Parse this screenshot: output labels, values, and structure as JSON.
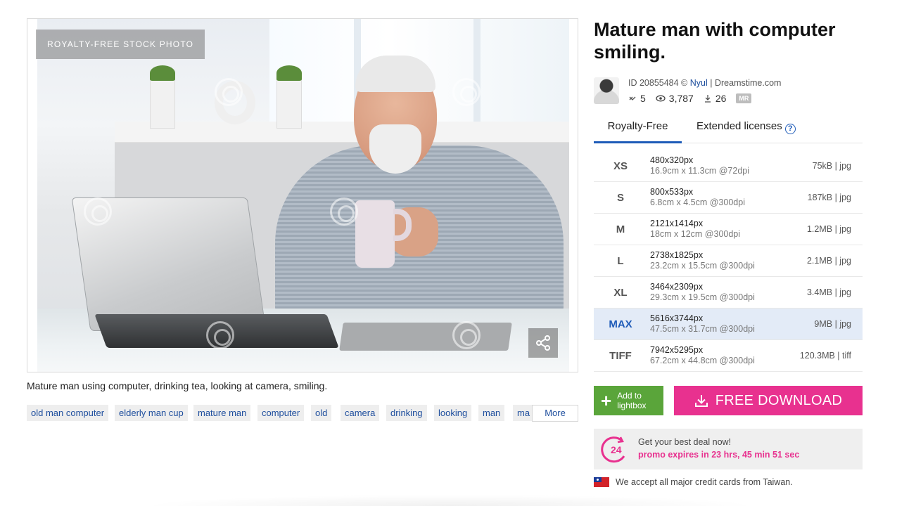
{
  "photo": {
    "badge": "ROYALTY-FREE STOCK PHOTO",
    "caption": "Mature man using computer, drinking tea, looking at camera, smiling."
  },
  "tags": [
    "old man computer",
    "elderly man cup",
    "mature man",
    "computer",
    "old",
    "camera",
    "drinking",
    "looking",
    "man",
    "ma"
  ],
  "more_label": "More",
  "title": "Mature man with computer smiling.",
  "meta": {
    "id_text": "ID 20855484 ©",
    "author": "Nyul",
    "site": "| Dreamstime.com"
  },
  "stats": {
    "likes": "5",
    "views": "3,787",
    "downloads": "26",
    "badge": "MR"
  },
  "tabs": {
    "royalty_free": "Royalty-Free",
    "extended": "Extended licenses",
    "help": "?"
  },
  "sizes": [
    {
      "code": "XS",
      "px": "480x320px",
      "cm": "16.9cm x 11.3cm @72dpi",
      "file": "75kB | jpg"
    },
    {
      "code": "S",
      "px": "800x533px",
      "cm": "6.8cm x 4.5cm @300dpi",
      "file": "187kB | jpg"
    },
    {
      "code": "M",
      "px": "2121x1414px",
      "cm": "18cm x 12cm @300dpi",
      "file": "1.2MB | jpg"
    },
    {
      "code": "L",
      "px": "2738x1825px",
      "cm": "23.2cm x 15.5cm @300dpi",
      "file": "2.1MB | jpg"
    },
    {
      "code": "XL",
      "px": "3464x2309px",
      "cm": "29.3cm x 19.5cm @300dpi",
      "file": "3.4MB | jpg"
    },
    {
      "code": "MAX",
      "px": "5616x3744px",
      "cm": "47.5cm x 31.7cm @300dpi",
      "file": "9MB | jpg"
    },
    {
      "code": "TIFF",
      "px": "7942x5295px",
      "cm": "67.2cm x 44.8cm @300dpi",
      "file": "120.3MB | tiff"
    }
  ],
  "buttons": {
    "lightbox_line1": "Add to",
    "lightbox_line2": "lightbox",
    "download": "FREE DOWNLOAD"
  },
  "promo": {
    "title": "Get your best deal now!",
    "timer": "promo expires in 23 hrs, 45 min 51 sec",
    "icon_text": "24"
  },
  "cards_note": "We accept all major credit cards from Taiwan.",
  "colors": {
    "accent_blue": "#1e5bb8",
    "download_pink": "#e8318f",
    "lightbox_green": "#5aa53a",
    "selected_row": "#e3ebf7"
  }
}
